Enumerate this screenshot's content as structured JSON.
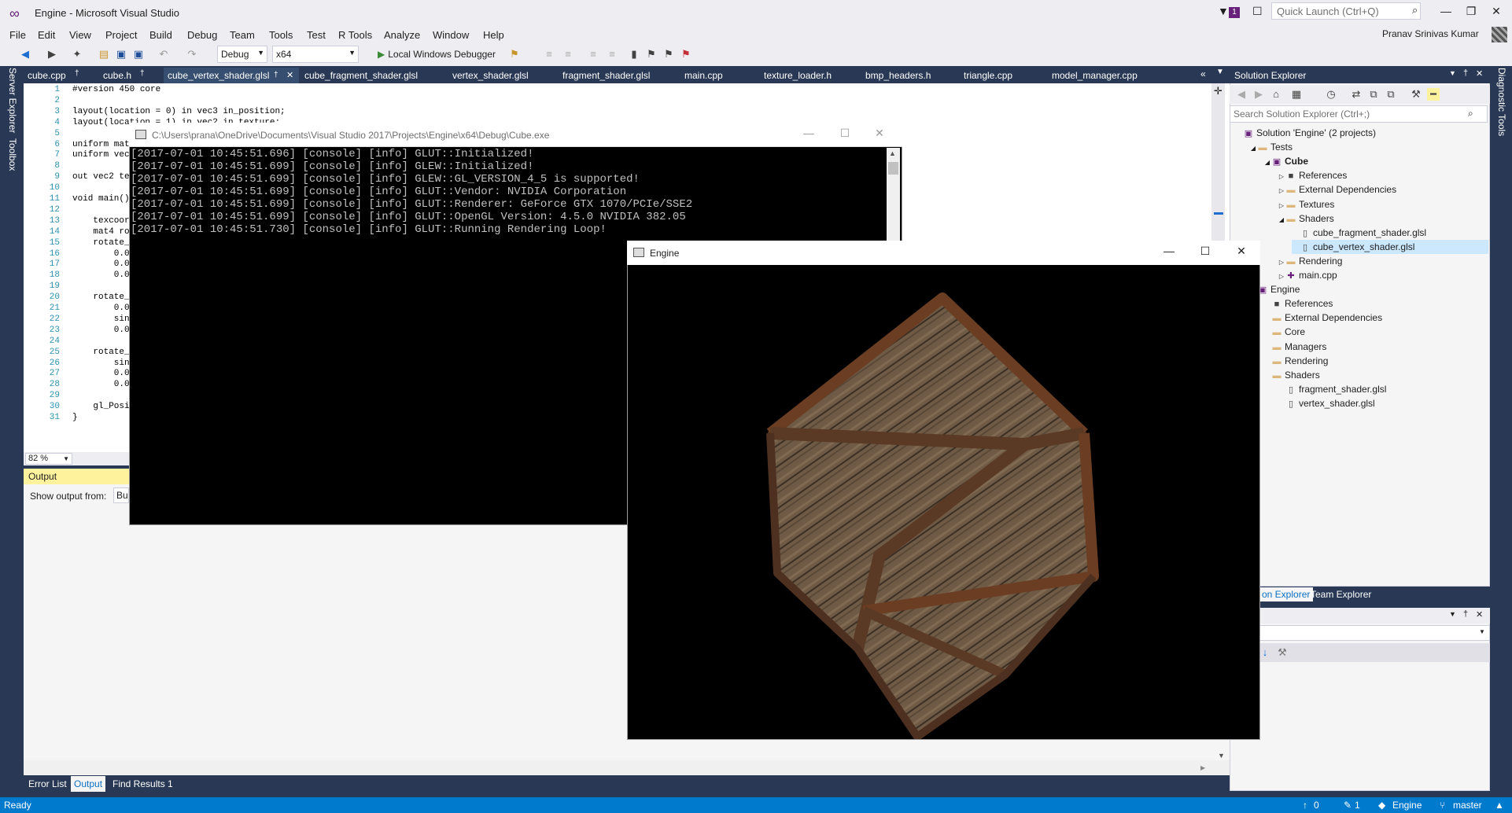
{
  "window": {
    "title": "Engine - Microsoft Visual Studio",
    "quick_launch_placeholder": "Quick Launch (Ctrl+Q)",
    "notification_count": "1",
    "user_name": "Pranav Srinivas Kumar"
  },
  "menu": [
    "File",
    "Edit",
    "View",
    "Project",
    "Build",
    "Debug",
    "Team",
    "Tools",
    "Test",
    "R Tools",
    "Analyze",
    "Window",
    "Help"
  ],
  "toolbar": {
    "configuration": "Debug",
    "platform": "x64",
    "debugger_label": "Local Windows Debugger"
  },
  "left_strip": [
    "Server Explorer",
    "Toolbox"
  ],
  "right_strip": [
    "Diagnostic Tools"
  ],
  "doc_tabs": [
    {
      "label": "cube.cpp"
    },
    {
      "label": "cube.h"
    },
    {
      "label": "cube_vertex_shader.glsl"
    },
    {
      "label": "cube_fragment_shader.glsl"
    },
    {
      "label": "vertex_shader.glsl"
    },
    {
      "label": "fragment_shader.glsl"
    },
    {
      "label": "main.cpp"
    },
    {
      "label": "texture_loader.h"
    },
    {
      "label": "bmp_headers.h"
    },
    {
      "label": "triangle.cpp"
    },
    {
      "label": "model_manager.cpp"
    }
  ],
  "editor": {
    "zoom": "82 %",
    "lines": [
      {
        "n": "1",
        "code": "#version 450 core"
      },
      {
        "n": "2",
        "code": ""
      },
      {
        "n": "3",
        "code": "layout(location = 0) in vec3 in_position;"
      },
      {
        "n": "4",
        "code": "layout(location = 1) in vec2 in_texture;"
      },
      {
        "n": "5",
        "code": ""
      },
      {
        "n": "6",
        "code": "uniform mat4"
      },
      {
        "n": "7",
        "code": "uniform vec3"
      },
      {
        "n": "8",
        "code": ""
      },
      {
        "n": "9",
        "code": "out vec2 tex"
      },
      {
        "n": "10",
        "code": ""
      },
      {
        "n": "11",
        "code": "void main()"
      },
      {
        "n": "12",
        "code": ""
      },
      {
        "n": "13",
        "code": "    texcoord"
      },
      {
        "n": "14",
        "code": "    mat4 rot"
      },
      {
        "n": "15",
        "code": "    rotate_x"
      },
      {
        "n": "16",
        "code": "        0.0,"
      },
      {
        "n": "17",
        "code": "        0.0,"
      },
      {
        "n": "18",
        "code": "        0.0,"
      },
      {
        "n": "19",
        "code": ""
      },
      {
        "n": "20",
        "code": "    rotate_y"
      },
      {
        "n": "21",
        "code": "        0.0,"
      },
      {
        "n": "22",
        "code": "        sin("
      },
      {
        "n": "23",
        "code": "        0.0,"
      },
      {
        "n": "24",
        "code": ""
      },
      {
        "n": "25",
        "code": "    rotate_z"
      },
      {
        "n": "26",
        "code": "        sin("
      },
      {
        "n": "27",
        "code": "        0.0,"
      },
      {
        "n": "28",
        "code": "        0.0,"
      },
      {
        "n": "29",
        "code": ""
      },
      {
        "n": "30",
        "code": "    gl_Posit"
      },
      {
        "n": "31",
        "code": "}"
      }
    ]
  },
  "output": {
    "title": "Output",
    "show_from_label": "Show output from:",
    "show_from_value": "Bu"
  },
  "bottom_tabs": [
    "Error List",
    "Output",
    "Find Results 1"
  ],
  "status": {
    "ready": "Ready",
    "pending_changes": "0",
    "commits": "1",
    "repo": "Engine",
    "branch": "master"
  },
  "solution_explorer": {
    "title": "Solution Explorer",
    "search_placeholder": "Search Solution Explorer (Ctrl+;)",
    "items": [
      {
        "label": "Solution 'Engine' (2 projects)",
        "level": 0,
        "arrow": "",
        "icon": "solution"
      },
      {
        "label": "Tests",
        "level": 1,
        "arrow": "◢",
        "icon": "folder"
      },
      {
        "label": "Cube",
        "level": 2,
        "arrow": "◢",
        "icon": "project",
        "bold": true
      },
      {
        "label": "References",
        "level": 3,
        "arrow": "▷",
        "icon": "refs"
      },
      {
        "label": "External Dependencies",
        "level": 3,
        "arrow": "▷",
        "icon": "folder"
      },
      {
        "label": "Textures",
        "level": 3,
        "arrow": "▷",
        "icon": "folder"
      },
      {
        "label": "Shaders",
        "level": 3,
        "arrow": "◢",
        "icon": "folder"
      },
      {
        "label": "cube_fragment_shader.glsl",
        "level": 4,
        "arrow": "",
        "icon": "file"
      },
      {
        "label": "cube_vertex_shader.glsl",
        "level": 4,
        "arrow": "",
        "icon": "file",
        "selected": true
      },
      {
        "label": "Rendering",
        "level": 3,
        "arrow": "▷",
        "icon": "folder"
      },
      {
        "label": "main.cpp",
        "level": 3,
        "arrow": "▷",
        "icon": "cpp"
      },
      {
        "label": "Engine",
        "level": 1,
        "arrow": "◢",
        "icon": "project"
      },
      {
        "label": "References",
        "level": 2,
        "arrow": "",
        "icon": "refs"
      },
      {
        "label": "External Dependencies",
        "level": 2,
        "arrow": "",
        "icon": "folder"
      },
      {
        "label": "Core",
        "level": 2,
        "arrow": "",
        "icon": "folder"
      },
      {
        "label": "Managers",
        "level": 2,
        "arrow": "",
        "icon": "folder"
      },
      {
        "label": "Rendering",
        "level": 2,
        "arrow": "",
        "icon": "folder"
      },
      {
        "label": "Shaders",
        "level": 2,
        "arrow": "",
        "icon": "folder"
      },
      {
        "label": "fragment_shader.glsl",
        "level": 3,
        "arrow": "",
        "icon": "file"
      },
      {
        "label": "vertex_shader.glsl",
        "level": 3,
        "arrow": "",
        "icon": "file"
      }
    ],
    "bottom_tabs": [
      "on Explorer",
      "Team Explorer"
    ]
  },
  "properties": {
    "title": "rties"
  },
  "console": {
    "title": "C:\\Users\\prana\\OneDrive\\Documents\\Visual Studio 2017\\Projects\\Engine\\x64\\Debug\\Cube.exe",
    "lines": [
      "[2017-07-01 10:45:51.696] [console] [info] GLUT::Initialized!",
      "[2017-07-01 10:45:51.699] [console] [info] GLEW::Initialized!",
      "[2017-07-01 10:45:51.699] [console] [info] GLEW::GL_VERSION_4_5 is supported!",
      "[2017-07-01 10:45:51.699] [console] [info] GLUT::Vendor: NVIDIA Corporation",
      "[2017-07-01 10:45:51.699] [console] [info] GLUT::Renderer: GeForce GTX 1070/PCIe/SSE2",
      "[2017-07-01 10:45:51.699] [console] [info] GLUT::OpenGL Version: 4.5.0 NVIDIA 382.05",
      "[2017-07-01 10:45:51.730] [console] [info] GLUT::Running Rendering Loop!"
    ]
  },
  "engine_window": {
    "title": "Engine"
  },
  "colors": {
    "vs_frame": "#293955",
    "status_bar": "#007acc",
    "accent": "#68217a",
    "selection": "#cce8ff"
  }
}
